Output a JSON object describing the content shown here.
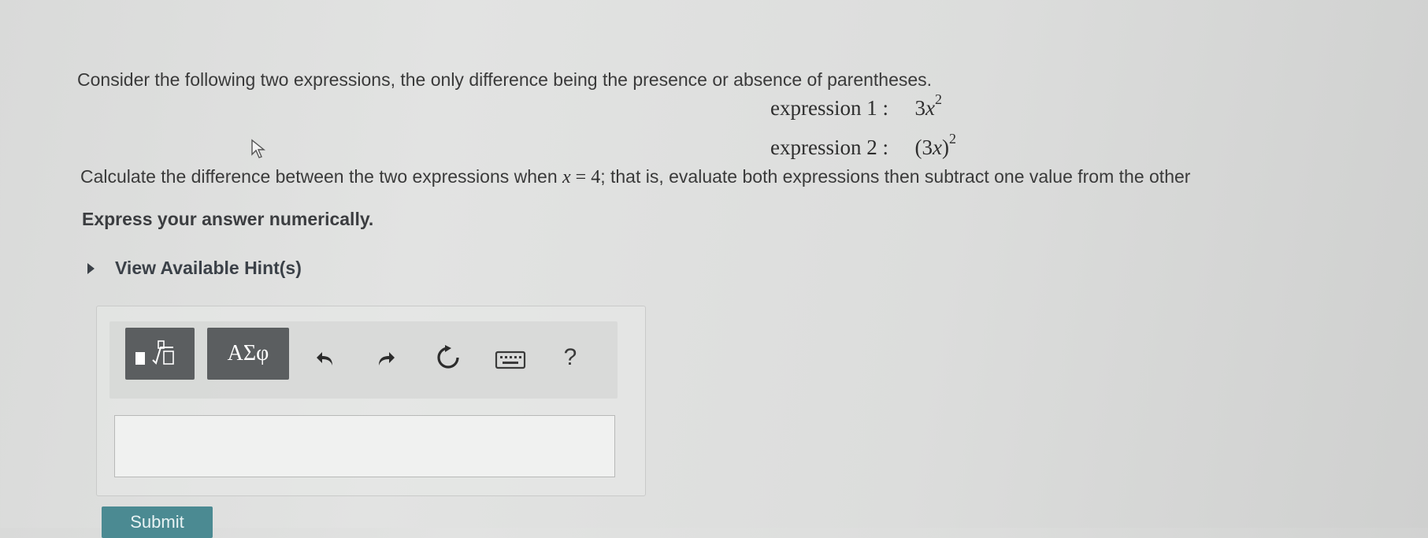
{
  "question": {
    "intro": "Consider the following two expressions, the only difference being the presence or absence of parentheses.",
    "expression1": {
      "label": "expression 1 :",
      "base": "3",
      "var": "x",
      "exp": "2"
    },
    "expression2": {
      "label": "expression 2 :",
      "open": "(3",
      "var": "x",
      "close": ")",
      "exp": "2"
    },
    "calc_before": "Calculate the difference between the two expressions when",
    "calc_var": "x",
    "calc_eq": " = 4",
    "calc_after": "; that is, evaluate both expressions then subtract one value from the other",
    "instruction": "Express your answer numerically."
  },
  "hint": {
    "label": "View Available Hint(s)"
  },
  "toolbar": {
    "greek_label": "ΑΣφ",
    "help_label": "?",
    "icons": [
      "templates-icon",
      "undo-icon",
      "redo-icon",
      "reset-icon",
      "keyboard-icon",
      "help-icon"
    ]
  },
  "answer": {
    "value": ""
  },
  "submit": {
    "label": "Submit"
  }
}
